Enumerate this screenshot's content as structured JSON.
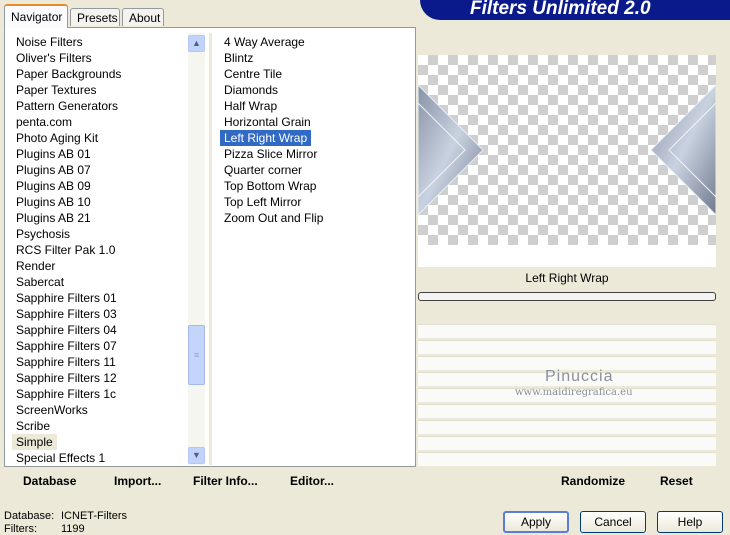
{
  "window": {
    "brand": "Filters Unlimited 2.0",
    "brand_color": "#0b1a8a"
  },
  "tabs": [
    {
      "label": "Navigator",
      "active": true
    },
    {
      "label": "Presets",
      "active": false
    },
    {
      "label": "About",
      "active": false
    }
  ],
  "categories": [
    "Noise Filters",
    "Oliver's Filters",
    "Paper Backgrounds",
    "Paper Textures",
    "Pattern Generators",
    "penta.com",
    "Photo Aging Kit",
    "Plugins AB 01",
    "Plugins AB 07",
    "Plugins AB 09",
    "Plugins AB 10",
    "Plugins AB 21",
    "Psychosis",
    "RCS Filter Pak 1.0",
    "Render",
    "Sabercat",
    "Sapphire Filters 01",
    "Sapphire Filters 03",
    "Sapphire Filters 04",
    "Sapphire Filters 07",
    "Sapphire Filters 11",
    "Sapphire Filters 12",
    "Sapphire Filters 1c",
    "ScreenWorks",
    "Scribe",
    "Simple",
    "Special Effects 1"
  ],
  "selected_category": "Simple",
  "filters": [
    "4 Way Average",
    "Blintz",
    "Centre Tile",
    "Diamonds",
    "Half Wrap",
    "Horizontal Grain",
    "Left Right Wrap",
    "Pizza Slice Mirror",
    "Quarter corner",
    "Top Bottom Wrap",
    "Top Left Mirror",
    "Zoom Out and Flip"
  ],
  "selected_filter": "Left Right Wrap",
  "left_buttons": {
    "database": "Database",
    "import": "Import...",
    "filter_info": "Filter Info...",
    "editor": "Editor..."
  },
  "preview": {
    "filter_name": "Left Right Wrap",
    "watermark_name": "Pinuccia",
    "watermark_url": "www.maidiregrafica.eu"
  },
  "right_buttons": {
    "randomize": "Randomize",
    "reset": "Reset"
  },
  "status": {
    "database_label": "Database:",
    "database_value": "ICNET-Filters",
    "filters_label": "Filters:",
    "filters_value": "1199"
  },
  "dialog_buttons": {
    "apply": "Apply",
    "cancel": "Cancel",
    "help": "Help"
  },
  "colors": {
    "selection": "#316ac5",
    "dialog_bg": "#ece9d8"
  }
}
